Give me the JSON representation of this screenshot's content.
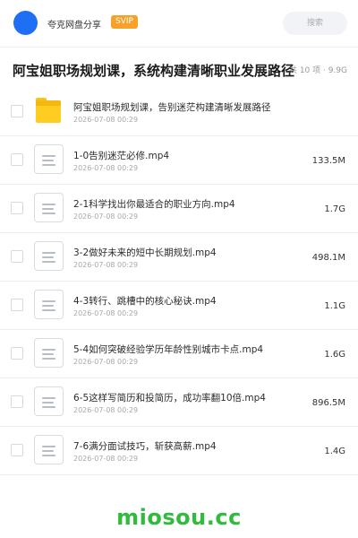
{
  "header": {
    "brand": "夸克网盘分享",
    "badge": "SVIP",
    "search_placeholder": "搜索"
  },
  "titlebar": {
    "title": "阿宝姐职场规划课，系统构建清晰职业发展路径",
    "meta": "共 10 项 · 9.9G"
  },
  "items": [
    {
      "type": "folder",
      "name": "阿宝姐职场规划课，告别迷茫构建清晰发展路径",
      "date": "2026-07-08 00:29",
      "size": ""
    },
    {
      "type": "file",
      "name": "1-0告别迷茫必修.mp4",
      "date": "2026-07-08 00:29",
      "size": "133.5M"
    },
    {
      "type": "file",
      "name": "2-1科学找出你最适合的职业方向.mp4",
      "date": "2026-07-08 00:29",
      "size": "1.7G"
    },
    {
      "type": "file",
      "name": "3-2做好未来的短中长期规划.mp4",
      "date": "2026-07-08 00:29",
      "size": "498.1M"
    },
    {
      "type": "file",
      "name": "4-3转行、跳槽中的核心秘诀.mp4",
      "date": "2026-07-08 00:29",
      "size": "1.1G"
    },
    {
      "type": "file",
      "name": "5-4如何突破经验学历年龄性别城市卡点.mp4",
      "date": "2026-07-08 00:29",
      "size": "1.6G"
    },
    {
      "type": "file",
      "name": "6-5这样写简历和投简历，成功率翻10倍.mp4",
      "date": "2026-07-08 00:29",
      "size": "896.5M"
    },
    {
      "type": "file",
      "name": "7-6满分面试技巧，斩获高薪.mp4",
      "date": "2026-07-08 00:29",
      "size": "1.4G"
    }
  ],
  "watermark": "miosou.cc"
}
